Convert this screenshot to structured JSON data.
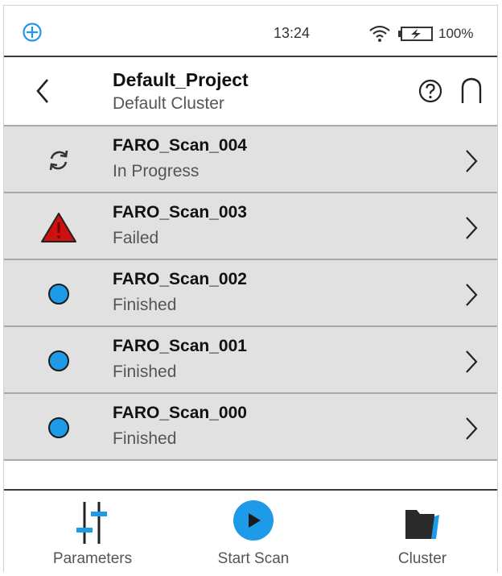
{
  "status_bar": {
    "time": "13:24",
    "battery_percent": "100%",
    "logo_icon": "faro-logo-icon",
    "wifi_icon": "wifi-icon",
    "battery_icon": "battery-charging-icon"
  },
  "header": {
    "title": "Default_Project",
    "subtitle": "Default Cluster",
    "back_icon": "chevron-left-icon",
    "help_icon": "help-circle-icon",
    "home_icon": "home-icon"
  },
  "scans": [
    {
      "name": "FARO_Scan_004",
      "status": "In Progress",
      "icon": "sync-icon"
    },
    {
      "name": "FARO_Scan_003",
      "status": "Failed",
      "icon": "warning-icon"
    },
    {
      "name": "FARO_Scan_002",
      "status": "Finished",
      "icon": "finished-dot-icon"
    },
    {
      "name": "FARO_Scan_001",
      "status": "Finished",
      "icon": "finished-dot-icon"
    },
    {
      "name": "FARO_Scan_000",
      "status": "Finished",
      "icon": "finished-dot-icon"
    }
  ],
  "toolbar": {
    "parameters_label": "Parameters",
    "start_scan_label": "Start Scan",
    "cluster_label": "Cluster"
  },
  "colors": {
    "accent_blue": "#1e9be8",
    "error_red": "#cc1111",
    "row_bg": "#e1e1e1",
    "icon_dark": "#2a2a2a"
  }
}
